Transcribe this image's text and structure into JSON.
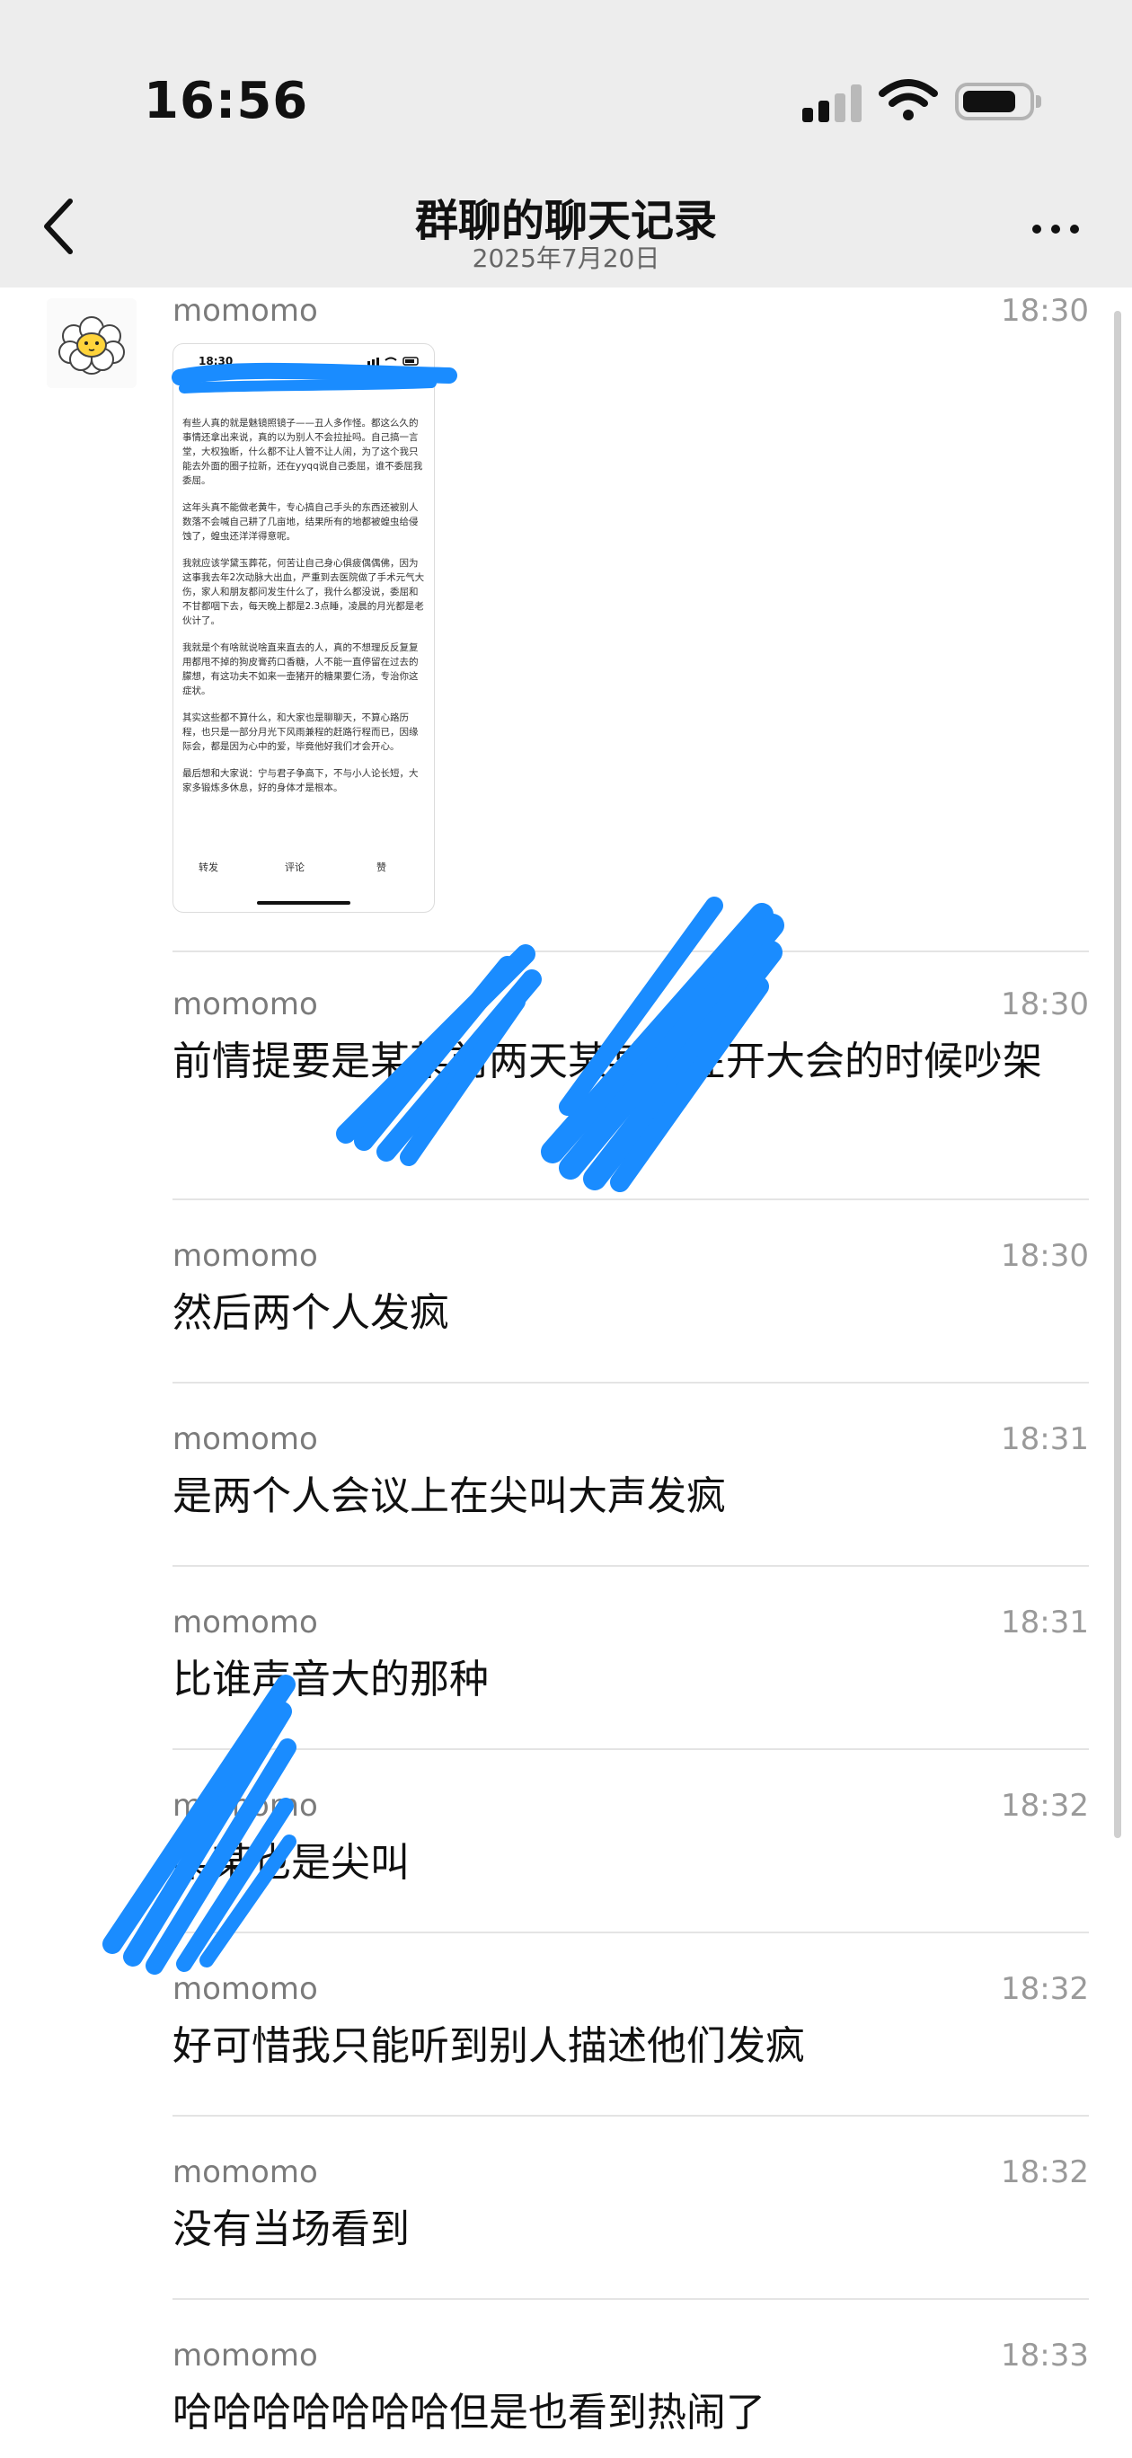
{
  "status_bar": {
    "time": "16:56"
  },
  "header": {
    "title": "群聊的聊天记录",
    "date": "2025年7月20日"
  },
  "colors": {
    "background": "#ffffff",
    "header_bg": "#ededed",
    "scribble": "#1a8cff",
    "divider": "#e4e4e4"
  },
  "icons": [
    "back-chevron-icon",
    "more-dots-icon",
    "signal-icon",
    "wifi-icon",
    "battery-icon",
    "avatar-sheep-icon"
  ],
  "first_message": {
    "sender": "momomo",
    "time": "18:30",
    "screenshot": {
      "time": "18:30",
      "paragraphs": [
        "有些人真的就是魅镜照镜子——丑人多作怪。都这么久的事情还拿出来说，真的以为别人不会拉扯吗。自己搞一言堂，大权独断，什么都不让人管不让人闹，为了这个我只能去外面的圈子拉新，还在yyqq说自己委屈，谁不委屈我委屈。",
        "这年头真不能做老黄牛，专心搞自己手头的东西还被别人数落不会喊自己耕了几亩地，结果所有的地都被蝗虫给侵蚀了，蝗虫还洋洋得意呢。",
        "我就应该学黛玉葬花，何苦让自己身心俱疲偶偶佛，因为这事我去年2次动脉大出血，严重到去医院做了手术元气大伤，家人和朋友都问发生什么了，我什么都没说，委屈和不甘都咽下去，每天晚上都是2.3点睡，凌晨的月光都是老伙计了。",
        "我就是个有啥就说啥直来直去的人，真的不想理反反复复用都甩不掉的狗皮膏药口香糖，人不能一直停留在过去的朦想，有这功夫不如来一壶猪开的糖果要仁汤，专治你这症状。",
        "其实这些都不算什么，和大家也是聊聊天，不算心路历程，也只是一部分月光下风雨兼程的赶路行程而已，因缘际会，都是因为心中的爱，毕竟他好我们才会开心。",
        "最后想和大家说：宁与君子争高下，不与小人论长短，大家多锻炼多休息，好的身体才是根本。"
      ],
      "actions": [
        "转发",
        "评论",
        "赞"
      ]
    }
  },
  "messages": [
    {
      "sender": "momomo",
      "time": "18:30",
      "text": "前情提要是某某前两天某某某在开大会的时候吵架"
    },
    {
      "sender": "momomo",
      "time": "18:30",
      "text": "然后两个人发疯"
    },
    {
      "sender": "momomo",
      "time": "18:31",
      "text": "是两个人会议上在尖叫大声发疯"
    },
    {
      "sender": "momomo",
      "time": "18:31",
      "text": "比谁声音大的那种"
    },
    {
      "sender": "momomo",
      "time": "18:32",
      "text": "某某也是尖叫"
    },
    {
      "sender": "momomo",
      "time": "18:32",
      "text": "好可惜我只能听到别人描述他们发疯"
    },
    {
      "sender": "momomo",
      "time": "18:32",
      "text": "没有当场看到"
    },
    {
      "sender": "momomo",
      "time": "18:33",
      "text": "哈哈哈哈哈哈哈但是也看到热闹了"
    }
  ]
}
